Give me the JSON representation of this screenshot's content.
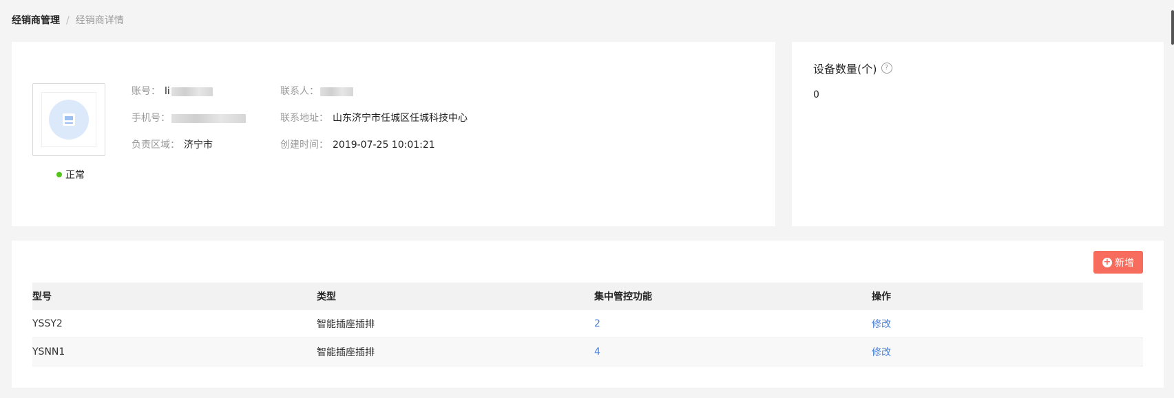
{
  "breadcrumb": {
    "parent": "经销商管理",
    "separator": "/",
    "current": "经销商详情"
  },
  "dealer": {
    "status": "正常",
    "status_color": "#52c41a",
    "fields": {
      "account_label": "账号：",
      "account_value": "li",
      "phone_label": "手机号：",
      "region_label": "负责区域：",
      "region_value": "济宁市",
      "contact_label": "联系人：",
      "address_label": "联系地址：",
      "address_value": "山东济宁市任城区任城科技中心",
      "created_label": "创建时间：",
      "created_value": "2019-07-25 10:01:21"
    }
  },
  "device": {
    "title": "设备数量(个)",
    "count": "0"
  },
  "table": {
    "add_label": "新增",
    "add_color": "#f86c5d",
    "headers": [
      "型号",
      "类型",
      "集中管控功能",
      "操作"
    ],
    "rows": [
      {
        "model": "YSSY2",
        "type": "智能插座插排",
        "func": "2",
        "action": "修改"
      },
      {
        "model": "YSNN1",
        "type": "智能插座插排",
        "func": "4",
        "action": "修改"
      }
    ]
  }
}
